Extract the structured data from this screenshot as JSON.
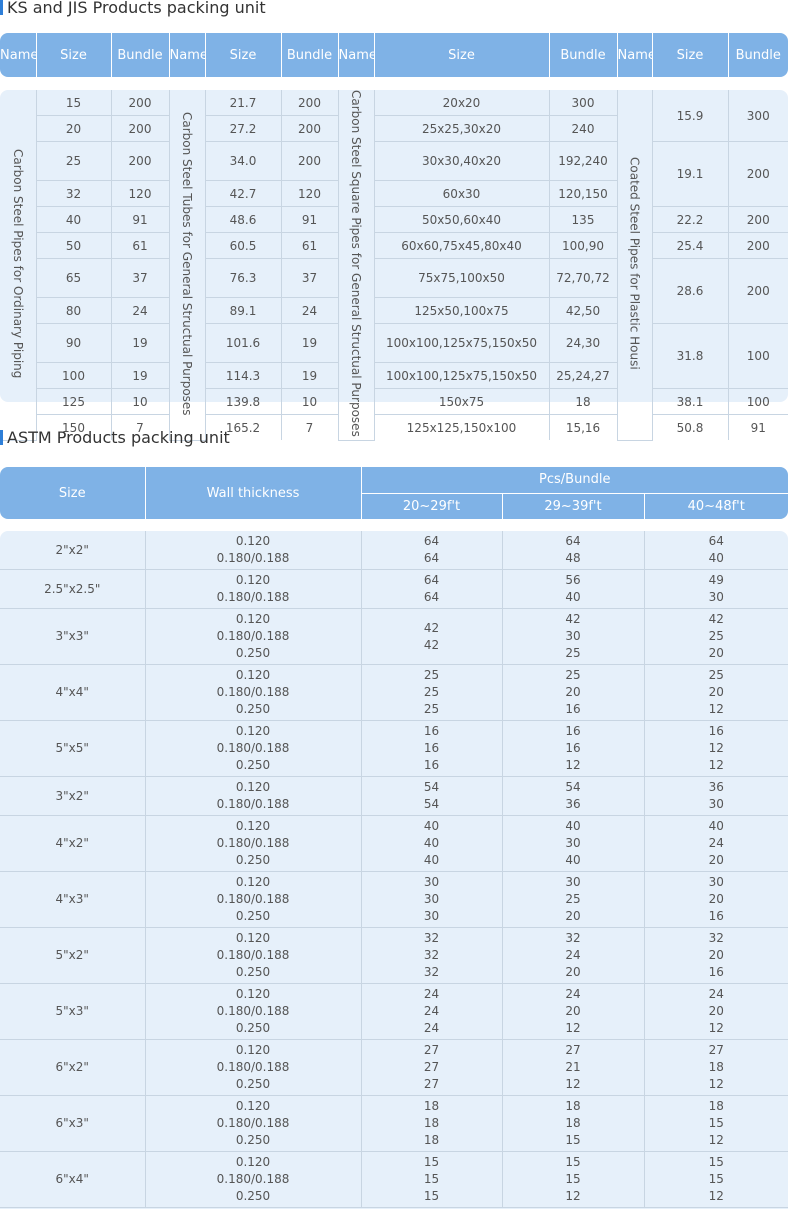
{
  "ks": {
    "title": "KS and JIS Products packing unit",
    "headers": [
      "Name",
      "Size",
      "Bundle",
      "Name",
      "Size",
      "Bundle",
      "Name",
      "Size",
      "Bundle",
      "Name",
      "Size",
      "Bundle"
    ],
    "group1": {
      "name": "Carbon Steel Pipes for Ordinary Piping",
      "rows": [
        [
          "15",
          "200"
        ],
        [
          "20",
          "200"
        ],
        [
          "25",
          "200"
        ],
        [
          "32",
          "120"
        ],
        [
          "40",
          "91"
        ],
        [
          "50",
          "61"
        ],
        [
          "65",
          "37"
        ],
        [
          "80",
          "24"
        ],
        [
          "90",
          "19"
        ],
        [
          "100",
          "19"
        ],
        [
          "125",
          "10"
        ],
        [
          "150",
          "7"
        ]
      ]
    },
    "group2": {
      "name": "Carbon Steel Tubes for General Structual Purposes",
      "rows": [
        [
          "21.7",
          "200"
        ],
        [
          "27.2",
          "200"
        ],
        [
          "34.0",
          "200"
        ],
        [
          "42.7",
          "120"
        ],
        [
          "48.6",
          "91"
        ],
        [
          "60.5",
          "61"
        ],
        [
          "76.3",
          "37"
        ],
        [
          "89.1",
          "24"
        ],
        [
          "101.6",
          "19"
        ],
        [
          "114.3",
          "19"
        ],
        [
          "139.8",
          "10"
        ],
        [
          "165.2",
          "7"
        ]
      ]
    },
    "group3": {
      "name": "Carbon Steel Square Pipes for General Structual Purposes",
      "rows": [
        [
          "20x20",
          "300"
        ],
        [
          "25x25,30x20",
          "240"
        ],
        [
          "30x30,40x20",
          "192,240"
        ],
        [
          "60x30",
          "120,150"
        ],
        [
          "50x50,60x40",
          "135"
        ],
        [
          "60x60,75x45,80x40",
          "100,90"
        ],
        [
          "75x75,100x50",
          "72,70,72"
        ],
        [
          "125x50,100x75",
          "42,50"
        ],
        [
          "100x100,125x75,150x50",
          "24,30"
        ],
        [
          "100x100,125x75,150x50",
          "25,24,27"
        ],
        [
          "150x75",
          "18"
        ],
        [
          "125x125,150x100",
          "15,16"
        ]
      ]
    },
    "group4": {
      "name": "Coated Steel Pipes for Plastic Housi",
      "rows": [
        [
          "15.9",
          "300"
        ],
        [
          "19.1",
          "200"
        ],
        [
          "22.2",
          "200"
        ],
        [
          "25.4",
          "200"
        ],
        [
          "28.6",
          "200"
        ],
        [
          "31.8",
          "100"
        ],
        [
          "38.1",
          "100"
        ],
        [
          "50.8",
          "91"
        ]
      ]
    }
  },
  "astm": {
    "title": "ASTM Products packing unit",
    "headers": {
      "size": "Size",
      "wall": "Wall thickness",
      "pcs": "Pcs/Bundle",
      "ranges": [
        "20~29f't",
        "29~39f't",
        "40~48f't"
      ]
    },
    "rows": [
      {
        "size": "2\"x2\"",
        "wall": [
          "0.120",
          "0.180/0.188"
        ],
        "c1": [
          "64",
          "64"
        ],
        "c2": [
          "64",
          "48"
        ],
        "c3": [
          "64",
          "40"
        ]
      },
      {
        "size": "2.5\"x2.5\"",
        "wall": [
          "0.120",
          "0.180/0.188"
        ],
        "c1": [
          "64",
          "64"
        ],
        "c2": [
          "56",
          "40"
        ],
        "c3": [
          "49",
          "30"
        ]
      },
      {
        "size": "3\"x3\"",
        "wall": [
          "0.120",
          "0.180/0.188",
          "0.250"
        ],
        "c1": [
          "42",
          "42"
        ],
        "c2": [
          "42",
          "30",
          "25"
        ],
        "c3": [
          "42",
          "25",
          "20"
        ]
      },
      {
        "size": "4\"x4\"",
        "wall": [
          "0.120",
          "0.180/0.188",
          "0.250"
        ],
        "c1": [
          "25",
          "25",
          "25"
        ],
        "c2": [
          "25",
          "20",
          "16"
        ],
        "c3": [
          "25",
          "20",
          "12"
        ]
      },
      {
        "size": "5\"x5\"",
        "wall": [
          "0.120",
          "0.180/0.188",
          "0.250"
        ],
        "c1": [
          "16",
          "16",
          "16"
        ],
        "c2": [
          "16",
          "16",
          "12"
        ],
        "c3": [
          "16",
          "12",
          "12"
        ]
      },
      {
        "size": "3\"x2\"",
        "wall": [
          "0.120",
          "0.180/0.188"
        ],
        "c1": [
          "54",
          "54"
        ],
        "c2": [
          "54",
          "36"
        ],
        "c3": [
          "36",
          "30"
        ]
      },
      {
        "size": "4\"x2\"",
        "wall": [
          "0.120",
          "0.180/0.188",
          "0.250"
        ],
        "c1": [
          "40",
          "40",
          "40"
        ],
        "c2": [
          "40",
          "30",
          "40"
        ],
        "c3": [
          "40",
          "24",
          "20"
        ]
      },
      {
        "size": "4\"x3\"",
        "wall": [
          "0.120",
          "0.180/0.188",
          "0.250"
        ],
        "c1": [
          "30",
          "30",
          "30"
        ],
        "c2": [
          "30",
          "25",
          "20"
        ],
        "c3": [
          "30",
          "20",
          "16"
        ]
      },
      {
        "size": "5\"x2\"",
        "wall": [
          "0.120",
          "0.180/0.188",
          "0.250"
        ],
        "c1": [
          "32",
          "32",
          "32"
        ],
        "c2": [
          "32",
          "24",
          "20"
        ],
        "c3": [
          "32",
          "20",
          "16"
        ]
      },
      {
        "size": "5\"x3\"",
        "wall": [
          "0.120",
          "0.180/0.188",
          "0.250"
        ],
        "c1": [
          "24",
          "24",
          "24"
        ],
        "c2": [
          "24",
          "20",
          "12"
        ],
        "c3": [
          "24",
          "20",
          "12"
        ]
      },
      {
        "size": "6\"x2\"",
        "wall": [
          "0.120",
          "0.180/0.188",
          "0.250"
        ],
        "c1": [
          "27",
          "27",
          "27"
        ],
        "c2": [
          "27",
          "21",
          "12"
        ],
        "c3": [
          "27",
          "18",
          "12"
        ]
      },
      {
        "size": "6\"x3\"",
        "wall": [
          "0.120",
          "0.180/0.188",
          "0.250"
        ],
        "c1": [
          "18",
          "18",
          "18"
        ],
        "c2": [
          "18",
          "18",
          "15"
        ],
        "c3": [
          "18",
          "15",
          "12"
        ]
      },
      {
        "size": "6\"x4\"",
        "wall": [
          "0.120",
          "0.180/0.188",
          "0.250"
        ],
        "c1": [
          "15",
          "15",
          "15"
        ],
        "c2": [
          "15",
          "15",
          "12"
        ],
        "c3": [
          "15",
          "15",
          "12"
        ]
      }
    ]
  },
  "colors": {
    "header_bg": "#7fb2e6",
    "body_bg": "#e6f0fa",
    "title_bar": "#2e7fd8",
    "grid": "#c8d5e2"
  }
}
